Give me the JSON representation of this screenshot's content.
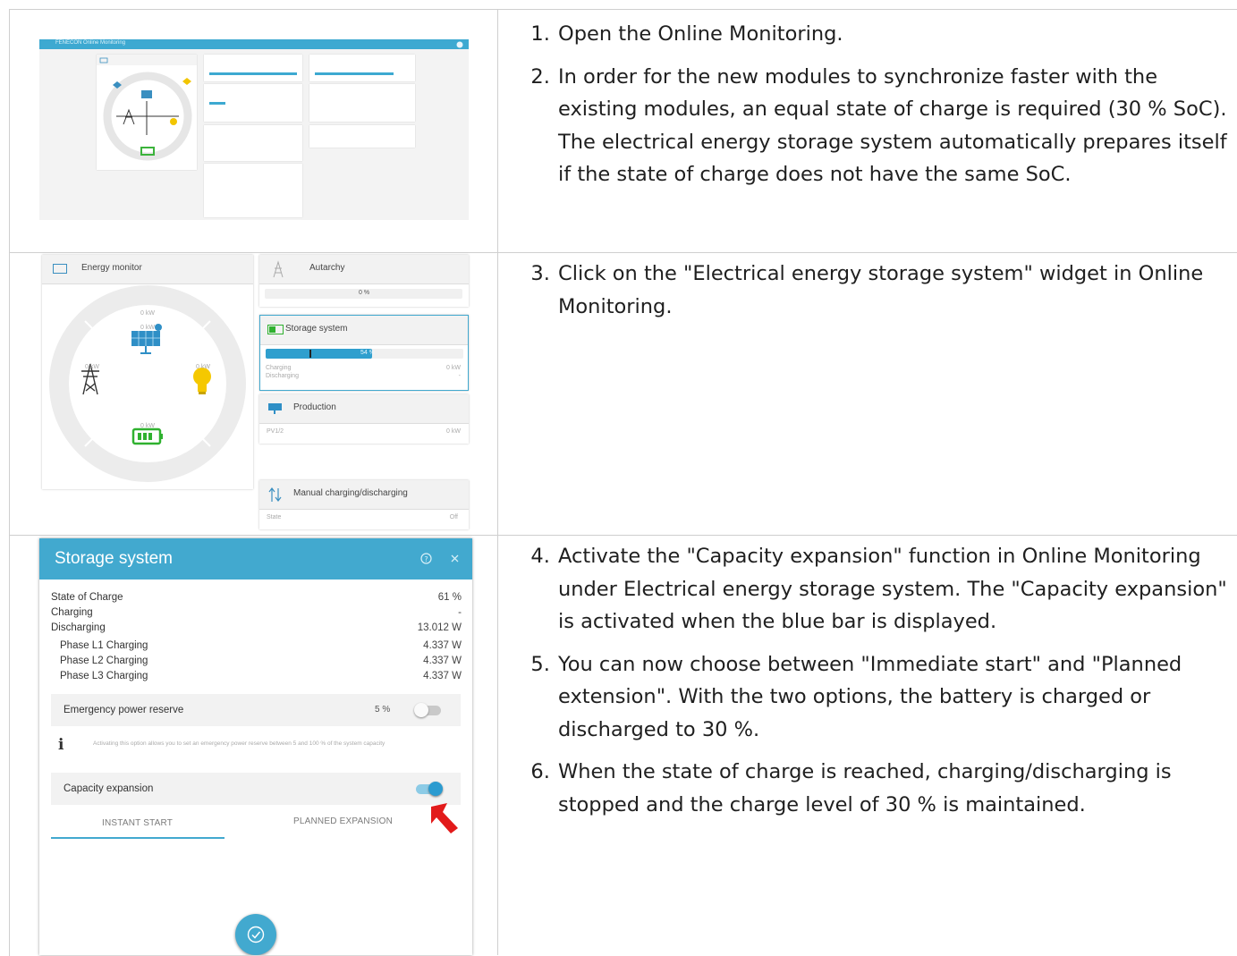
{
  "instructions": {
    "step1": "Open the Online Monitoring.",
    "step2": "In order for the new modules to synchronize faster with the existing modules, an equal state of charge is required (30 % SoC). The electrical energy storage system automatically prepares itself if the state of charge does not have the same SoC.",
    "step3": "Click on the \"Electrical energy storage system\" widget in Online Monitoring.",
    "step4": "Activate the \"Capacity expansion\" function in Online Monitoring under Electrical energy storage system. The \"Capacity expansion\" is activated when the blue bar is displayed.",
    "step5": "You can now choose between \"Immediate start\" and \"Planned extension\". With the two options, the battery is charged or discharged to 30 %.",
    "step6": "When the state of charge is reached, charging/discharging is stopped and the charge level of 30 % is maintained."
  },
  "screenshot1": {
    "app_title": "FENECON Online Monitoring"
  },
  "screenshot2": {
    "energy_monitor": "Energy monitor",
    "autarchy": "Autarchy",
    "autarchy_value": "0 %",
    "storage_system": "Storage system",
    "storage_value": "54 %",
    "storage_percent": 54,
    "charging": "Charging",
    "charging_value": "0 kW",
    "discharging": "Discharging",
    "discharging_value": "-",
    "production": "Production",
    "pv_label": "PV1/2",
    "pv_value": "0 kW",
    "manual": "Manual charging/discharging",
    "state": "State",
    "state_value": "Off",
    "flow_top": "0 kW",
    "flow_left": "0 kW",
    "flow_right": "0 kW",
    "flow_bottom": "0 kW",
    "flow_center_top": "0 kW"
  },
  "dialog": {
    "title": "Storage system",
    "rows": [
      {
        "label": "State of Charge",
        "value": "61 %"
      },
      {
        "label": "Charging",
        "value": "-"
      },
      {
        "label": "Discharging",
        "value": "13.012 W"
      },
      {
        "label": "Phase L1 Charging",
        "value": "4.337 W"
      },
      {
        "label": "Phase L2 Charging",
        "value": "4.337 W"
      },
      {
        "label": "Phase L3 Charging",
        "value": "4.337 W"
      }
    ],
    "emergency_label": "Emergency power reserve",
    "emergency_value": "5 %",
    "info_text": "Activating this option allows you to set an emergency power reserve between 5 and 100 % of the system capacity",
    "capacity_label": "Capacity expansion",
    "tab_instant": "INSTANT START",
    "tab_planned": "PLANNED EXPANSION",
    "accent": "#42a9cf"
  }
}
